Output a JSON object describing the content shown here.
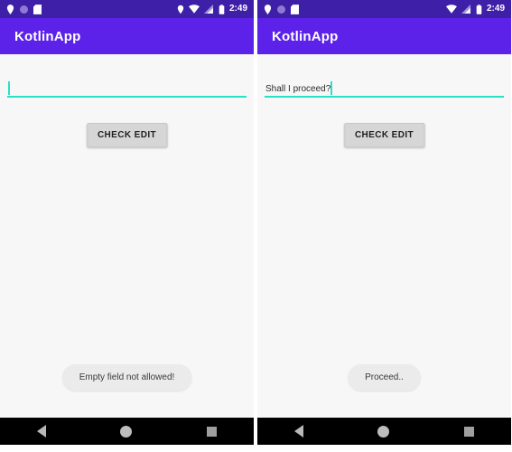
{
  "app": {
    "title": "KotlinApp",
    "accent_purple": "#5c22ea",
    "statusbar_purple": "#3d1fa8",
    "edit_underline_teal": "#28e0c8",
    "button_gray": "#d6d6d6",
    "toast_gray": "#ebebeb",
    "background": "#f7f7f7"
  },
  "screens": [
    {
      "statusbar": {
        "time": "2:49",
        "left_icons": [
          "location-pin-icon",
          "circle-dot-icon",
          "sd-card-icon"
        ],
        "right_icons": [
          "location-pin-icon",
          "wifi-icon",
          "signal-icon",
          "battery-icon"
        ]
      },
      "appbar": {
        "title": "KotlinApp"
      },
      "edit_field": {
        "value": "",
        "placeholder": "",
        "caret_visible": true
      },
      "button": {
        "label": "CHECK EDIT"
      },
      "toast": {
        "message": "Empty field not allowed!"
      },
      "navbar": {
        "back": "back-triangle-icon",
        "home": "home-circle-icon",
        "recents": "recents-square-icon"
      }
    },
    {
      "statusbar": {
        "time": "2:49",
        "left_icons": [
          "location-pin-icon",
          "circle-dot-icon",
          "sd-card-icon"
        ],
        "right_icons": [
          "wifi-icon",
          "signal-icon",
          "battery-icon"
        ]
      },
      "appbar": {
        "title": "KotlinApp"
      },
      "edit_field": {
        "value": "Shall I proceed?",
        "placeholder": "",
        "caret_visible": true
      },
      "button": {
        "label": "CHECK EDIT"
      },
      "toast": {
        "message": "Proceed.."
      },
      "navbar": {
        "back": "back-triangle-icon",
        "home": "home-circle-icon",
        "recents": "recents-square-icon"
      }
    }
  ]
}
